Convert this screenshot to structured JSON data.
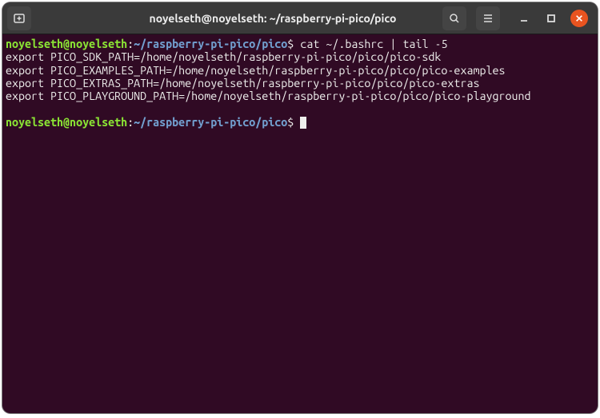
{
  "titlebar": {
    "title": "noyelseth@noyelseth: ~/raspberry-pi-pico/pico"
  },
  "prompt": {
    "userhost": "noyelseth@noyelseth",
    "colon": ":",
    "path": "~/raspberry-pi-pico/pico",
    "sigil": "$"
  },
  "session": {
    "command": "cat ~/.bashrc | tail -5",
    "output_lines": [
      "export PICO_SDK_PATH=/home/noyelseth/raspberry-pi-pico/pico/pico-sdk",
      "export PICO_EXAMPLES_PATH=/home/noyelseth/raspberry-pi-pico/pico/pico-examples",
      "export PICO_EXTRAS_PATH=/home/noyelseth/raspberry-pi-pico/pico/pico-extras",
      "export PICO_PLAYGROUND_PATH=/home/noyelseth/raspberry-pi-pico/pico/pico-playground"
    ]
  },
  "colors": {
    "terminal_bg": "#300a24",
    "titlebar_bg": "#3a3a3a",
    "close_btn": "#e95420",
    "prompt_user": "#8ae234",
    "prompt_path": "#729fcf",
    "text": "#eeeeec"
  }
}
